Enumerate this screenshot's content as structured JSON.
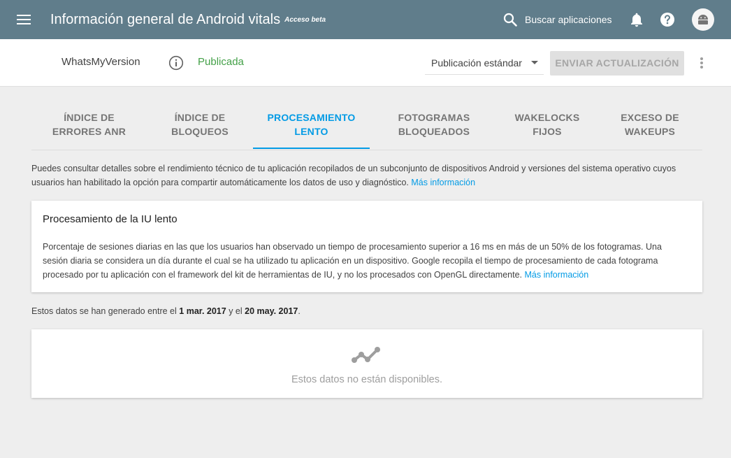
{
  "appbar": {
    "title": "Información general de Android vitals",
    "beta": "Acceso beta",
    "search_label": "Buscar aplicaciones",
    "background": "#607d8b"
  },
  "subbar": {
    "app_name": "WhatsMyVersion",
    "status": "Publicada",
    "status_color": "#43a047",
    "select_value": "Publicación estándar",
    "send_button": "ENVIAR ACTUALIZACIÓN"
  },
  "tabs": [
    {
      "line1": "ÍNDICE DE",
      "line2": "ERRORES ANR",
      "active": false
    },
    {
      "line1": "ÍNDICE DE",
      "line2": "BLOQUEOS",
      "active": false
    },
    {
      "line1": "PROCESAMIENTO",
      "line2": "LENTO",
      "active": true
    },
    {
      "line1": "FOTOGRAMAS",
      "line2": "BLOQUEADOS",
      "active": false
    },
    {
      "line1": "WAKELOCKS",
      "line2": "FIJOS",
      "active": false
    },
    {
      "line1": "EXCESO DE",
      "line2": "WAKEUPS",
      "active": false
    }
  ],
  "accent": "#039be5",
  "description": {
    "text": "Puedes consultar detalles sobre el rendimiento técnico de tu aplicación recopilados de un subconjunto de dispositivos Android y versiones del sistema operativo cuyos usuarios han habilitado la opción para compartir automáticamente los datos de uso y diagnóstico.",
    "link": "Más información"
  },
  "info_card": {
    "title": "Procesamiento de la IU lento",
    "body": "Porcentaje de sesiones diarias en las que los usuarios han observado un tiempo de procesamiento superior a 16 ms en más de un 50% de los fotogramas. Una sesión diaria se considera un día durante el cual se ha utilizado tu aplicación en un dispositivo. Google recopila el tiempo de procesamiento de cada fotograma procesado por tu aplicación con el framework del kit de herramientas de IU, y no los procesados con OpenGL directamente.",
    "link": "Más información"
  },
  "date_range": {
    "prefix": "Estos datos se han generado entre el",
    "start": "1 mar. 2017",
    "middle": "y el",
    "end": "20 may. 2017",
    "suffix": "."
  },
  "empty_card": {
    "icon": "line-chart-icon",
    "message": "Estos datos no están disponibles."
  }
}
